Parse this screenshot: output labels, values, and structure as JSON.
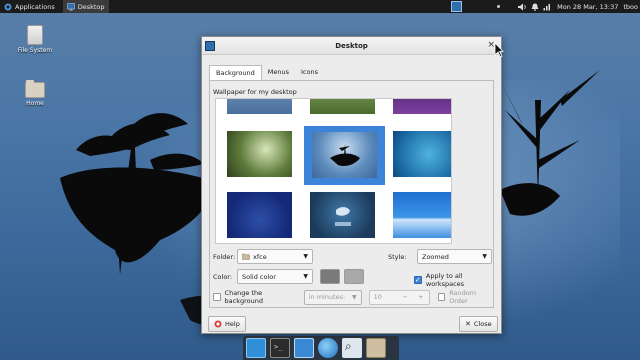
{
  "top_panel": {
    "applications_label": "Applications",
    "window_label": "Desktop",
    "clock": "Mon 28 Mar, 13:37",
    "user": "tboo",
    "icons": [
      "applications-icon",
      "desktop-window-icon",
      "volume-icon",
      "notifications-icon",
      "network-icon"
    ]
  },
  "desktop": {
    "icons": [
      {
        "label": "File System",
        "icon": "drive-icon"
      },
      {
        "label": "Home",
        "icon": "home-folder-icon"
      }
    ]
  },
  "dialog": {
    "title": "Desktop",
    "tabs": [
      {
        "label": "Background",
        "active": true
      },
      {
        "label": "Menus",
        "active": false
      },
      {
        "label": "Icons",
        "active": false
      }
    ],
    "wallpaper_label": "Wallpaper for my desktop",
    "folder": {
      "label": "Folder:",
      "value": "xfce"
    },
    "style": {
      "label": "Style:",
      "value": "Zoomed"
    },
    "color": {
      "label": "Color:",
      "value": "Solid color",
      "swatch1": "#7a7a7a",
      "swatch2": "#a8a8a8"
    },
    "apply_all": {
      "label": "Apply to all workspaces",
      "checked": true
    },
    "change_bg": {
      "label": "Change the background",
      "checked": false
    },
    "interval": {
      "value": "in minutes:"
    },
    "spinner": {
      "value": "10",
      "minus": "−",
      "plus": "+"
    },
    "random_order": {
      "label": "Random Order",
      "checked": false
    },
    "help_label": "Help",
    "close_label": "Close"
  },
  "colors": {
    "accent": "#3d84d8",
    "panel": "#1b1b1b",
    "dialog_bg": "#ececec"
  }
}
